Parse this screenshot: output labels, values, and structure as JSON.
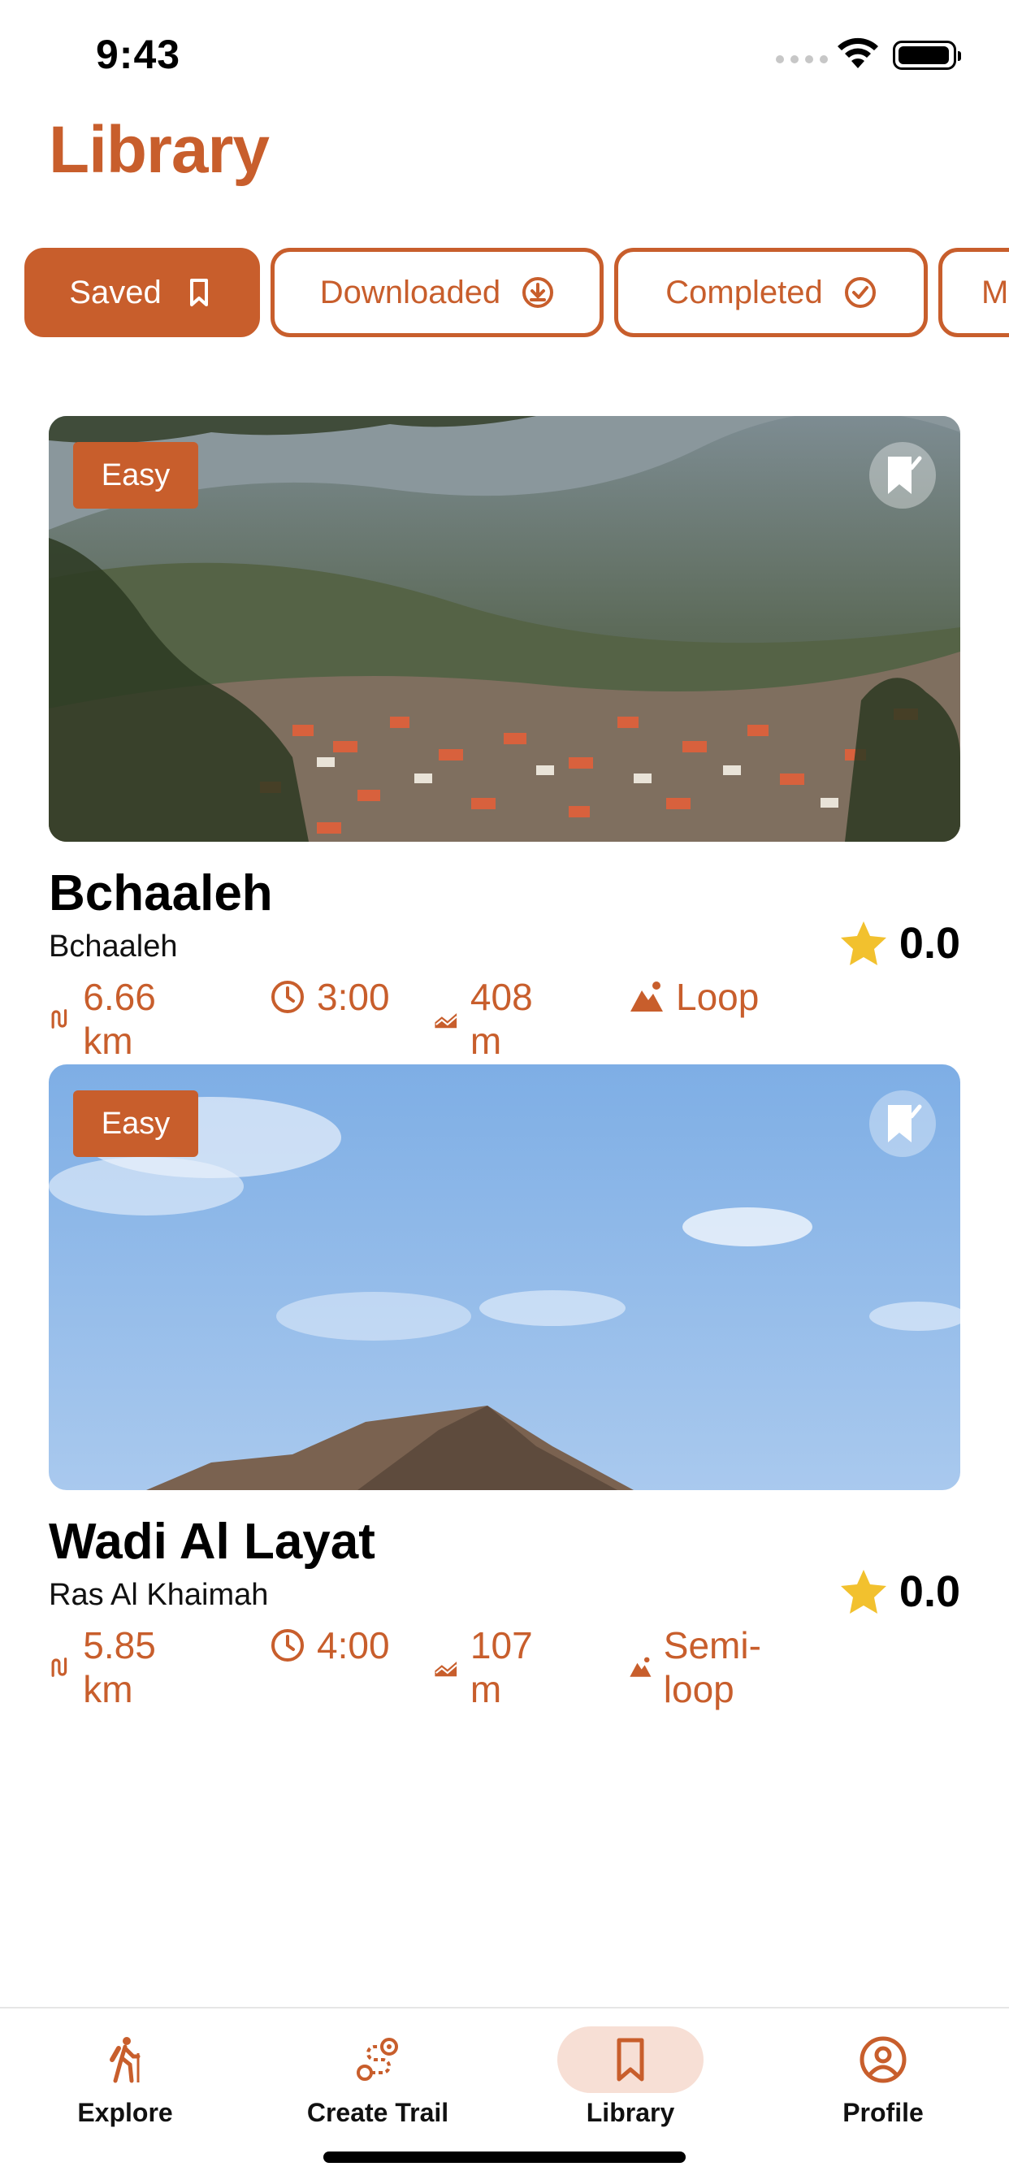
{
  "status_bar": {
    "time": "9:43"
  },
  "page": {
    "title": "Library"
  },
  "filters": [
    {
      "label": "Saved",
      "icon": "bookmark-icon",
      "active": true
    },
    {
      "label": "Downloaded",
      "icon": "download-icon",
      "active": false
    },
    {
      "label": "Completed",
      "icon": "check-circle-icon",
      "active": false
    },
    {
      "label": "M",
      "icon": "",
      "active": false
    }
  ],
  "trails": [
    {
      "difficulty": "Easy",
      "name": "Bchaaleh",
      "region": "Bchaaleh",
      "rating": "0.0",
      "distance": "6.66 km",
      "duration": "3:00",
      "elevation": "408 m",
      "route_type": "Loop",
      "saved": true
    },
    {
      "difficulty": "Easy",
      "name": "Wadi Al Layat",
      "region": "Ras Al Khaimah",
      "rating": "0.0",
      "distance": "5.85 km",
      "duration": "4:00",
      "elevation": "107 m",
      "route_type": "Semi-loop",
      "saved": true
    }
  ],
  "tabbar": {
    "items": [
      {
        "label": "Explore",
        "icon": "hiker-icon",
        "active": false
      },
      {
        "label": "Create Trail",
        "icon": "route-icon",
        "active": false
      },
      {
        "label": "Library",
        "icon": "bookmark-icon",
        "active": true
      },
      {
        "label": "Profile",
        "icon": "profile-icon",
        "active": false
      }
    ]
  },
  "colors": {
    "accent": "#c85e2c",
    "active_tab_bg": "#f7dfd5",
    "star": "#f2c12e"
  }
}
